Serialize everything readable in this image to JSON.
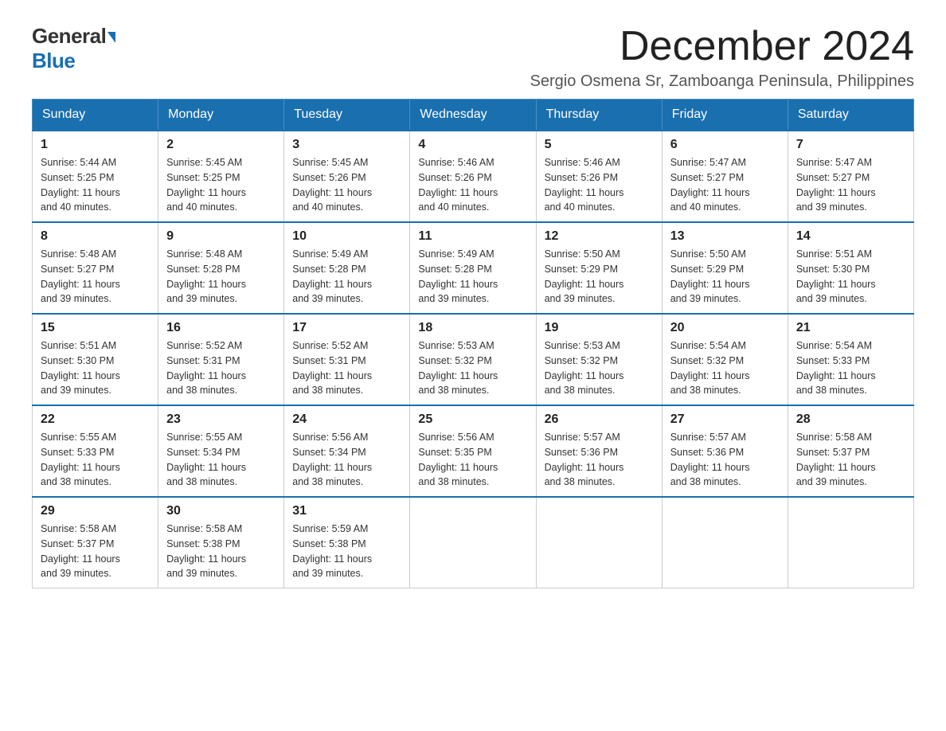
{
  "logo": {
    "general": "General",
    "blue": "Blue"
  },
  "title": "December 2024",
  "location": "Sergio Osmena Sr, Zamboanga Peninsula, Philippines",
  "headers": [
    "Sunday",
    "Monday",
    "Tuesday",
    "Wednesday",
    "Thursday",
    "Friday",
    "Saturday"
  ],
  "weeks": [
    [
      {
        "day": "1",
        "sunrise": "5:44 AM",
        "sunset": "5:25 PM",
        "daylight": "11 hours and 40 minutes."
      },
      {
        "day": "2",
        "sunrise": "5:45 AM",
        "sunset": "5:25 PM",
        "daylight": "11 hours and 40 minutes."
      },
      {
        "day": "3",
        "sunrise": "5:45 AM",
        "sunset": "5:26 PM",
        "daylight": "11 hours and 40 minutes."
      },
      {
        "day": "4",
        "sunrise": "5:46 AM",
        "sunset": "5:26 PM",
        "daylight": "11 hours and 40 minutes."
      },
      {
        "day": "5",
        "sunrise": "5:46 AM",
        "sunset": "5:26 PM",
        "daylight": "11 hours and 40 minutes."
      },
      {
        "day": "6",
        "sunrise": "5:47 AM",
        "sunset": "5:27 PM",
        "daylight": "11 hours and 40 minutes."
      },
      {
        "day": "7",
        "sunrise": "5:47 AM",
        "sunset": "5:27 PM",
        "daylight": "11 hours and 39 minutes."
      }
    ],
    [
      {
        "day": "8",
        "sunrise": "5:48 AM",
        "sunset": "5:27 PM",
        "daylight": "11 hours and 39 minutes."
      },
      {
        "day": "9",
        "sunrise": "5:48 AM",
        "sunset": "5:28 PM",
        "daylight": "11 hours and 39 minutes."
      },
      {
        "day": "10",
        "sunrise": "5:49 AM",
        "sunset": "5:28 PM",
        "daylight": "11 hours and 39 minutes."
      },
      {
        "day": "11",
        "sunrise": "5:49 AM",
        "sunset": "5:28 PM",
        "daylight": "11 hours and 39 minutes."
      },
      {
        "day": "12",
        "sunrise": "5:50 AM",
        "sunset": "5:29 PM",
        "daylight": "11 hours and 39 minutes."
      },
      {
        "day": "13",
        "sunrise": "5:50 AM",
        "sunset": "5:29 PM",
        "daylight": "11 hours and 39 minutes."
      },
      {
        "day": "14",
        "sunrise": "5:51 AM",
        "sunset": "5:30 PM",
        "daylight": "11 hours and 39 minutes."
      }
    ],
    [
      {
        "day": "15",
        "sunrise": "5:51 AM",
        "sunset": "5:30 PM",
        "daylight": "11 hours and 39 minutes."
      },
      {
        "day": "16",
        "sunrise": "5:52 AM",
        "sunset": "5:31 PM",
        "daylight": "11 hours and 38 minutes."
      },
      {
        "day": "17",
        "sunrise": "5:52 AM",
        "sunset": "5:31 PM",
        "daylight": "11 hours and 38 minutes."
      },
      {
        "day": "18",
        "sunrise": "5:53 AM",
        "sunset": "5:32 PM",
        "daylight": "11 hours and 38 minutes."
      },
      {
        "day": "19",
        "sunrise": "5:53 AM",
        "sunset": "5:32 PM",
        "daylight": "11 hours and 38 minutes."
      },
      {
        "day": "20",
        "sunrise": "5:54 AM",
        "sunset": "5:32 PM",
        "daylight": "11 hours and 38 minutes."
      },
      {
        "day": "21",
        "sunrise": "5:54 AM",
        "sunset": "5:33 PM",
        "daylight": "11 hours and 38 minutes."
      }
    ],
    [
      {
        "day": "22",
        "sunrise": "5:55 AM",
        "sunset": "5:33 PM",
        "daylight": "11 hours and 38 minutes."
      },
      {
        "day": "23",
        "sunrise": "5:55 AM",
        "sunset": "5:34 PM",
        "daylight": "11 hours and 38 minutes."
      },
      {
        "day": "24",
        "sunrise": "5:56 AM",
        "sunset": "5:34 PM",
        "daylight": "11 hours and 38 minutes."
      },
      {
        "day": "25",
        "sunrise": "5:56 AM",
        "sunset": "5:35 PM",
        "daylight": "11 hours and 38 minutes."
      },
      {
        "day": "26",
        "sunrise": "5:57 AM",
        "sunset": "5:36 PM",
        "daylight": "11 hours and 38 minutes."
      },
      {
        "day": "27",
        "sunrise": "5:57 AM",
        "sunset": "5:36 PM",
        "daylight": "11 hours and 38 minutes."
      },
      {
        "day": "28",
        "sunrise": "5:58 AM",
        "sunset": "5:37 PM",
        "daylight": "11 hours and 39 minutes."
      }
    ],
    [
      {
        "day": "29",
        "sunrise": "5:58 AM",
        "sunset": "5:37 PM",
        "daylight": "11 hours and 39 minutes."
      },
      {
        "day": "30",
        "sunrise": "5:58 AM",
        "sunset": "5:38 PM",
        "daylight": "11 hours and 39 minutes."
      },
      {
        "day": "31",
        "sunrise": "5:59 AM",
        "sunset": "5:38 PM",
        "daylight": "11 hours and 39 minutes."
      },
      null,
      null,
      null,
      null
    ]
  ],
  "labels": {
    "sunrise": "Sunrise:",
    "sunset": "Sunset:",
    "daylight": "Daylight:"
  }
}
